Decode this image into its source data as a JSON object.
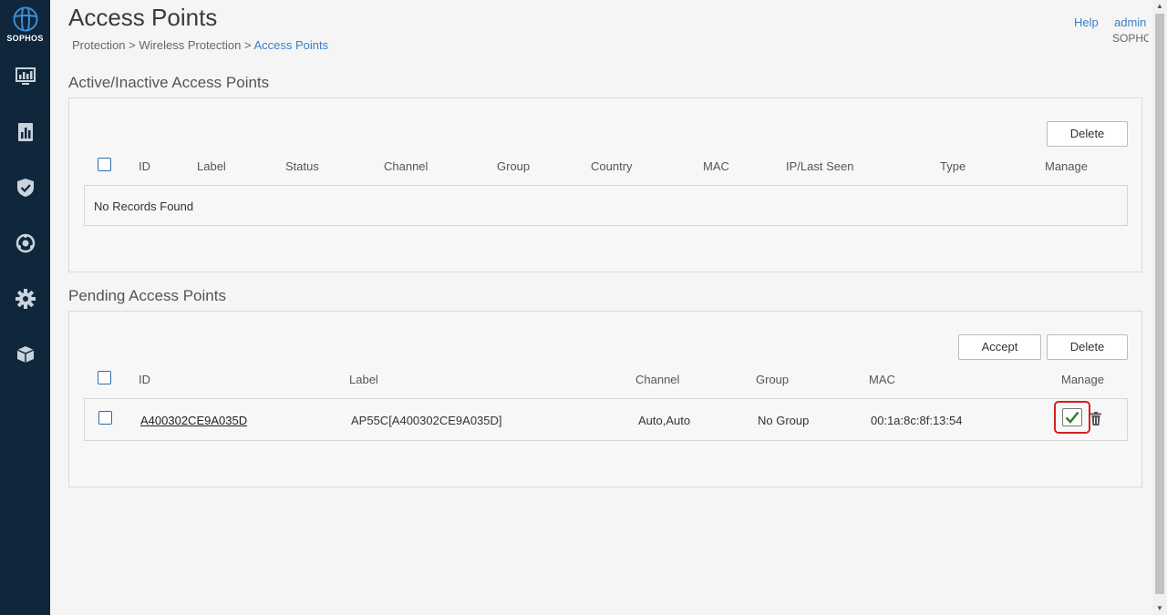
{
  "brand": {
    "name": "SOPHOS"
  },
  "sidebar": {
    "items": [
      {
        "icon": "monitor-icon"
      },
      {
        "icon": "reports-icon"
      },
      {
        "icon": "shield-icon"
      },
      {
        "icon": "protection-icon"
      },
      {
        "icon": "gear-icon"
      },
      {
        "icon": "box-icon"
      }
    ]
  },
  "header": {
    "title": "Access Points",
    "breadcrumb": {
      "item1": "Protection",
      "sep1": " > ",
      "item2": "Wireless Protection",
      "sep2": " > ",
      "current": "Access Points"
    },
    "help": "Help",
    "user": "admin",
    "org": "SOPHOS"
  },
  "active_section": {
    "title": "Active/Inactive Access Points",
    "delete_label": "Delete",
    "columns": [
      "ID",
      "Label",
      "Status",
      "Channel",
      "Group",
      "Country",
      "MAC",
      "IP/Last Seen",
      "Type",
      "Manage"
    ],
    "empty_text": "No Records Found"
  },
  "pending_section": {
    "title": "Pending Access Points",
    "accept_label": "Accept",
    "delete_label": "Delete",
    "columns": [
      "ID",
      "Label",
      "Channel",
      "Group",
      "MAC",
      "Manage"
    ],
    "rows": [
      {
        "id": "A400302CE9A035D",
        "label": "AP55C[A400302CE9A035D]",
        "channel": "Auto,Auto",
        "group": "No Group",
        "mac": "00:1a:8c:8f:13:54"
      }
    ]
  },
  "colors": {
    "sidebar_bg": "#10263a",
    "link": "#3b7fc4",
    "highlight": "#d62020",
    "check": "#2e7d32"
  }
}
